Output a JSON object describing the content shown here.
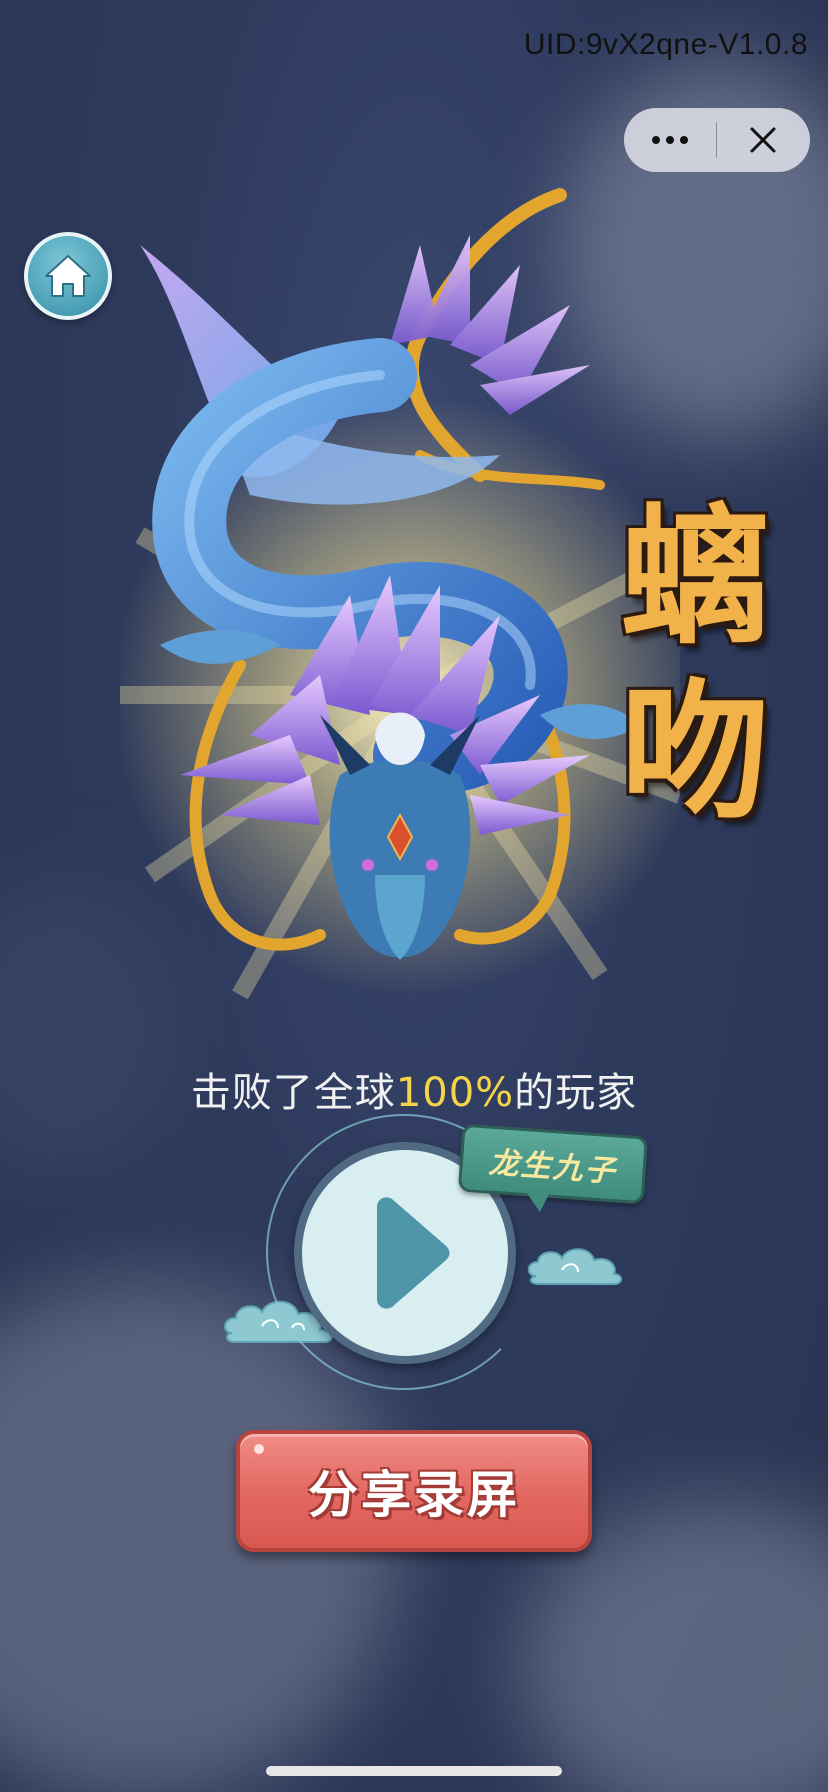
{
  "status": {
    "uid_text": "UID:9vX2qne-V1.0.8"
  },
  "capsule": {
    "more_icon": "ellipsis-icon",
    "close_icon": "close-icon"
  },
  "home": {
    "icon": "home-icon"
  },
  "result": {
    "character_name_line1": "螭",
    "character_name_line2": "吻",
    "defeat_prefix": "击败了全球",
    "defeat_percent": "100%",
    "defeat_suffix": "的玩家"
  },
  "replay": {
    "play_icon": "play-icon",
    "badge_text": "龙生九子"
  },
  "share": {
    "label": "分享录屏"
  },
  "colors": {
    "background": "#2e3a5c",
    "title_gold": "#f2b24a",
    "percent_yellow": "#f6d44a",
    "share_red": "#e46a64",
    "badge_green": "#4e9c8c",
    "play_teal": "#4f95a8"
  }
}
